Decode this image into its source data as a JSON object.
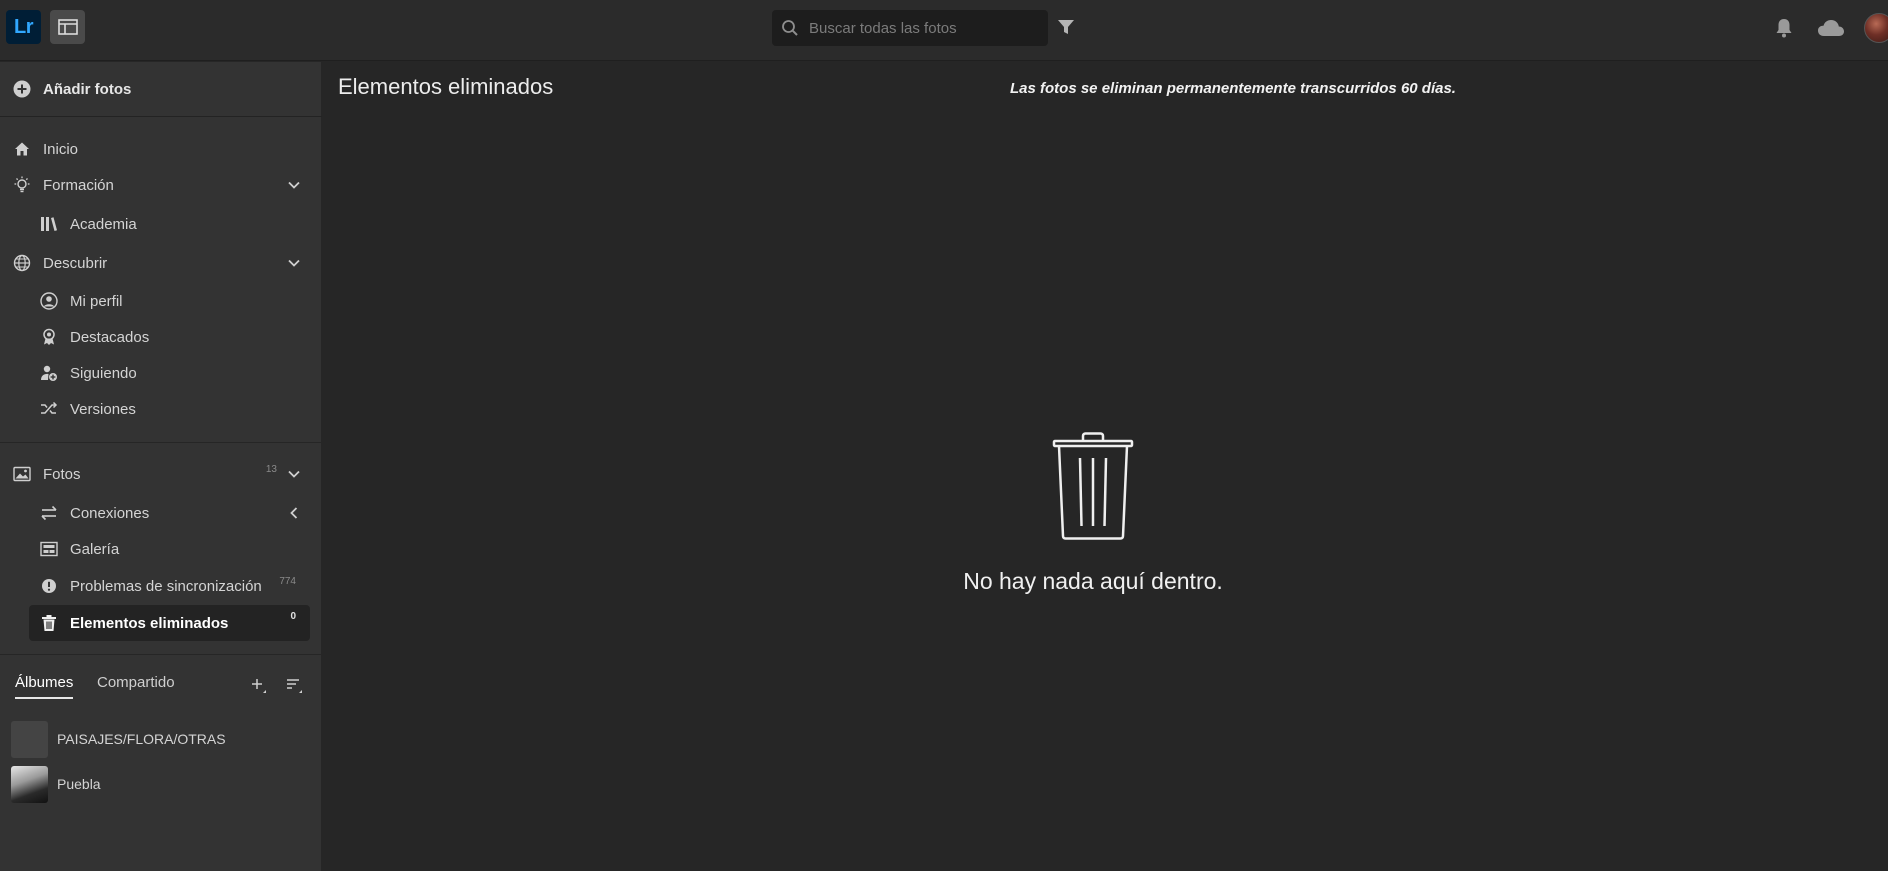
{
  "app": {
    "logo_text": "Lr",
    "search_placeholder": "Buscar todas las fotos"
  },
  "sidebar": {
    "add_photos": "Añadir fotos",
    "nav": {
      "inicio": "Inicio",
      "formacion": "Formación",
      "academia": "Academia",
      "descubrir": "Descubrir",
      "mi_perfil": "Mi perfil",
      "destacados": "Destacados",
      "siguiendo": "Siguiendo",
      "versiones": "Versiones",
      "fotos": "Fotos",
      "fotos_count": "13",
      "conexiones": "Conexiones",
      "galeria": "Galería",
      "problemas": "Problemas de sincronización",
      "problemas_count": "774",
      "eliminados": "Elementos eliminados",
      "eliminados_count": "0"
    },
    "album_tabs": {
      "albums": "Álbumes",
      "shared": "Compartido"
    },
    "albums": [
      {
        "name": "PAISAJES/FLORA/OTRAS"
      },
      {
        "name": "Puebla"
      }
    ]
  },
  "main": {
    "title": "Elementos eliminados",
    "notice": "Las fotos se eliminan permanentemente transcurridos 60 días.",
    "empty_text": "No hay nada aquí dentro."
  },
  "colors": {
    "background": "#262626",
    "sidebar": "#333333",
    "topbar": "#2b2b2b",
    "lr_blue": "#31a8ff",
    "lr_dark": "#001e36"
  }
}
